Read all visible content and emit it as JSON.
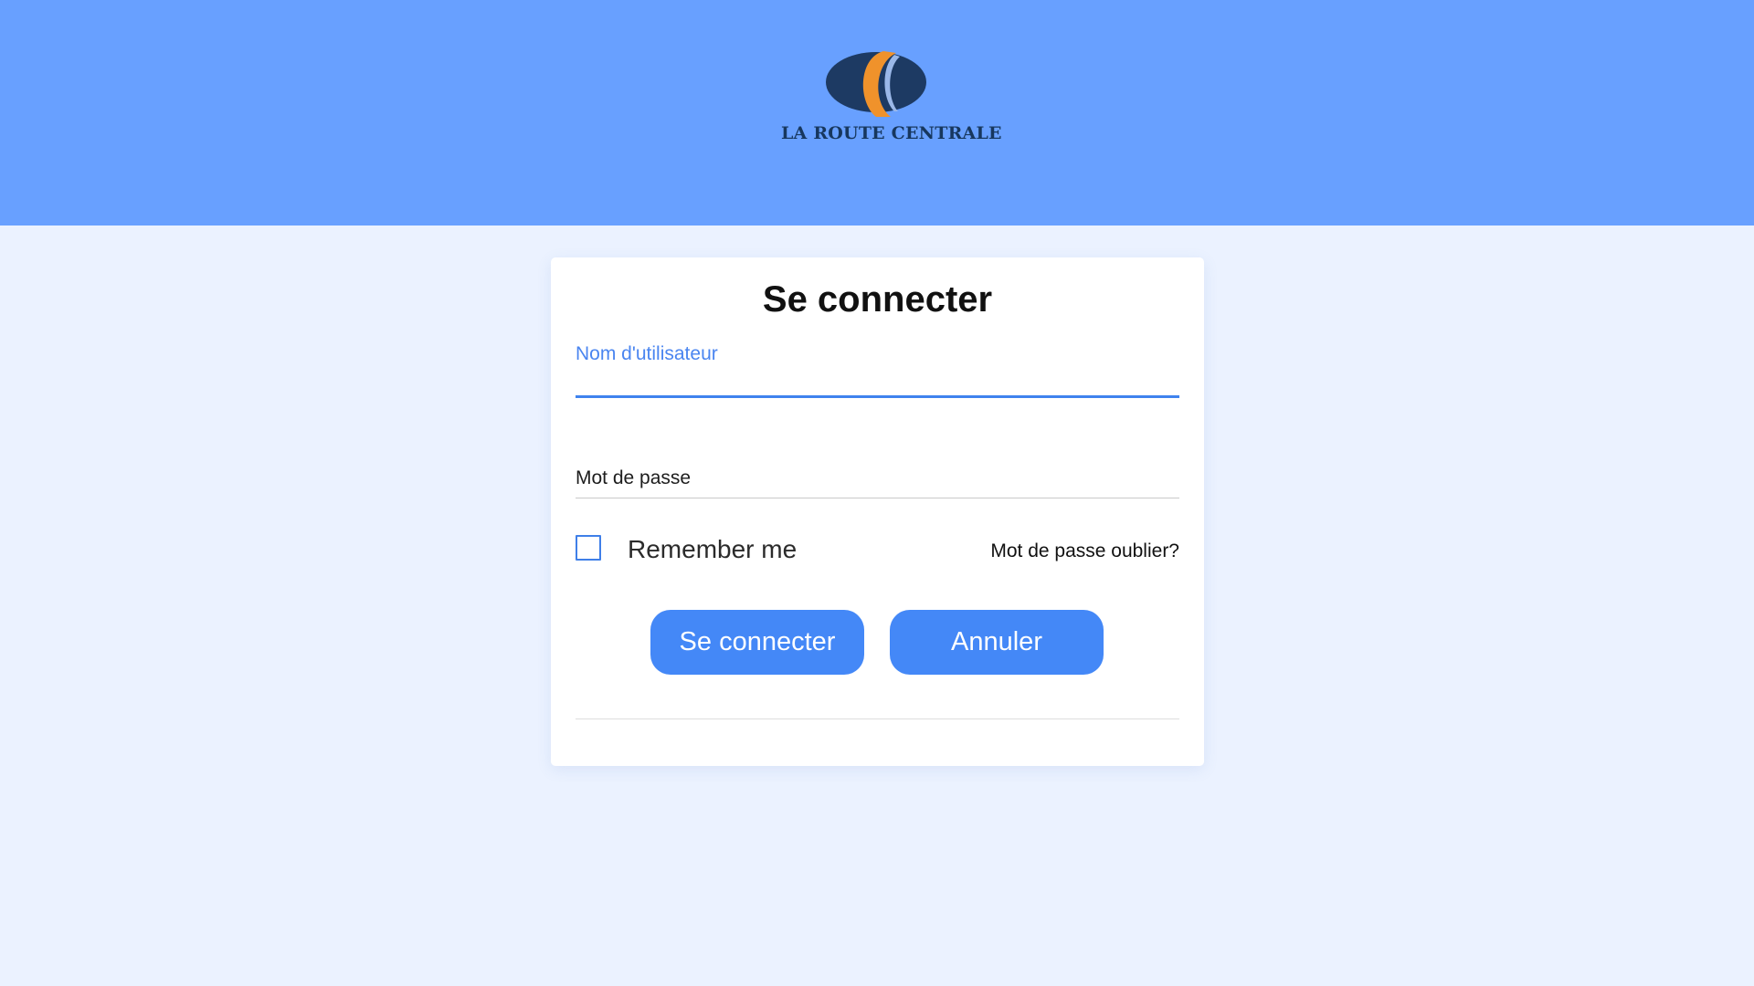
{
  "header": {
    "logo_text": "LA ROUTE CENTRALE",
    "background_color": "#68a0ff"
  },
  "login_form": {
    "title": "Se connecter",
    "username_label": "Nom d'utilisateur",
    "username_value": "",
    "password_placeholder": "Mot de passe",
    "password_value": "",
    "remember_me_label": "Remember me",
    "remember_me_checked": false,
    "forgot_password_link": "Mot de passe oublier?",
    "submit_button": "Se connecter",
    "cancel_button": "Annuler"
  },
  "colors": {
    "page_background": "#ebf2ff",
    "accent": "#4488f7",
    "logo_dark": "#17375e",
    "logo_orange": "#f0922b"
  }
}
